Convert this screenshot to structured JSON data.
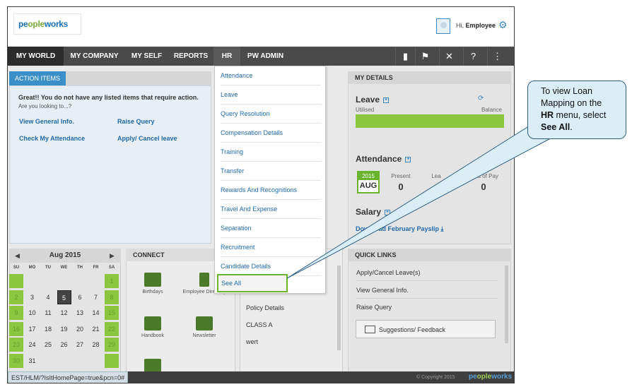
{
  "header": {
    "logo_text_a": "pe",
    "logo_text_b": "ople",
    "logo_text_c": "works",
    "greeting_prefix": "Hi,",
    "user_name": "Employee"
  },
  "nav": {
    "items": [
      "MY WORLD",
      "MY COMPANY",
      "MY SELF",
      "REPORTS",
      "HR",
      "PW ADMIN"
    ],
    "active": "MY WORLD"
  },
  "action_items": {
    "tab_label": "ACTION ITEMS",
    "message": "Great!! You do not have any listed items that require action.",
    "sub": "Are you looking to...?",
    "links": [
      "View General Info.",
      "Raise Query",
      "Check My Attendance",
      "Apply/ Cancel leave"
    ]
  },
  "my_details": {
    "title": "MY DETAILS",
    "leave_label": "Leave",
    "utilised_label": "Utilised",
    "balance_label": "Balance",
    "attendance_label": "Attendance",
    "cal_year": "2015",
    "cal_month": "AUG",
    "present_label": "Present",
    "present_value": "0",
    "leave_short": "Lea",
    "loss_label": "Loss of Pay",
    "loss_value": "0",
    "salary_label": "Salary",
    "payslip_link": "Download February Payslip"
  },
  "calendar": {
    "month": "Aug 2015",
    "dow": [
      "SU",
      "MO",
      "TU",
      "WE",
      "TH",
      "FR",
      "SA"
    ],
    "rows": [
      [
        "",
        "",
        "",
        "",
        "",
        "",
        "1"
      ],
      [
        "2",
        "3",
        "4",
        "5",
        "6",
        "7",
        "8"
      ],
      [
        "9",
        "10",
        "11",
        "12",
        "13",
        "14",
        "15"
      ],
      [
        "16",
        "17",
        "18",
        "19",
        "20",
        "21",
        "22"
      ],
      [
        "23",
        "24",
        "25",
        "26",
        "27",
        "28",
        "29"
      ],
      [
        "30",
        "31",
        "",
        "",
        "",
        "",
        ""
      ]
    ],
    "today": "5"
  },
  "connect": {
    "title": "CONNECT",
    "tiles": [
      "Birthdays",
      "Employee Directory",
      "Handbook",
      "Newsletter"
    ]
  },
  "center_list": {
    "items": [
      "Policy Details",
      "CLASS A",
      "wert"
    ]
  },
  "quick_links": {
    "title": "QUICK LINKS",
    "items": [
      "Apply/Cancel Leave(s)",
      "View General Info.",
      "Raise Query"
    ],
    "feedback_button": "Suggestions/ Feedback"
  },
  "hr_menu": {
    "items": [
      "Attendance",
      "Leave",
      "Query Resolution",
      "Compensation Details",
      "Training",
      "Transfer",
      "Rewards And Recognitions",
      "Travel And Expense",
      "Separation",
      "Recruitment",
      "Candidate Details"
    ],
    "see_all": "See All"
  },
  "footer": {
    "url": "EST/HLM/?IsItHomePage=true&pcn=0#",
    "copyright": "© Copyright 2015"
  },
  "callout": {
    "line1": "To view Loan",
    "line2": "Mapping on the",
    "menu_word": "HR",
    "line3_rest": " menu, select",
    "see_all": "See All",
    "period": "."
  },
  "colors": {
    "accent": "#3b8fc9",
    "green": "#8cc63f",
    "nav_bg": "#4a4a4a"
  }
}
